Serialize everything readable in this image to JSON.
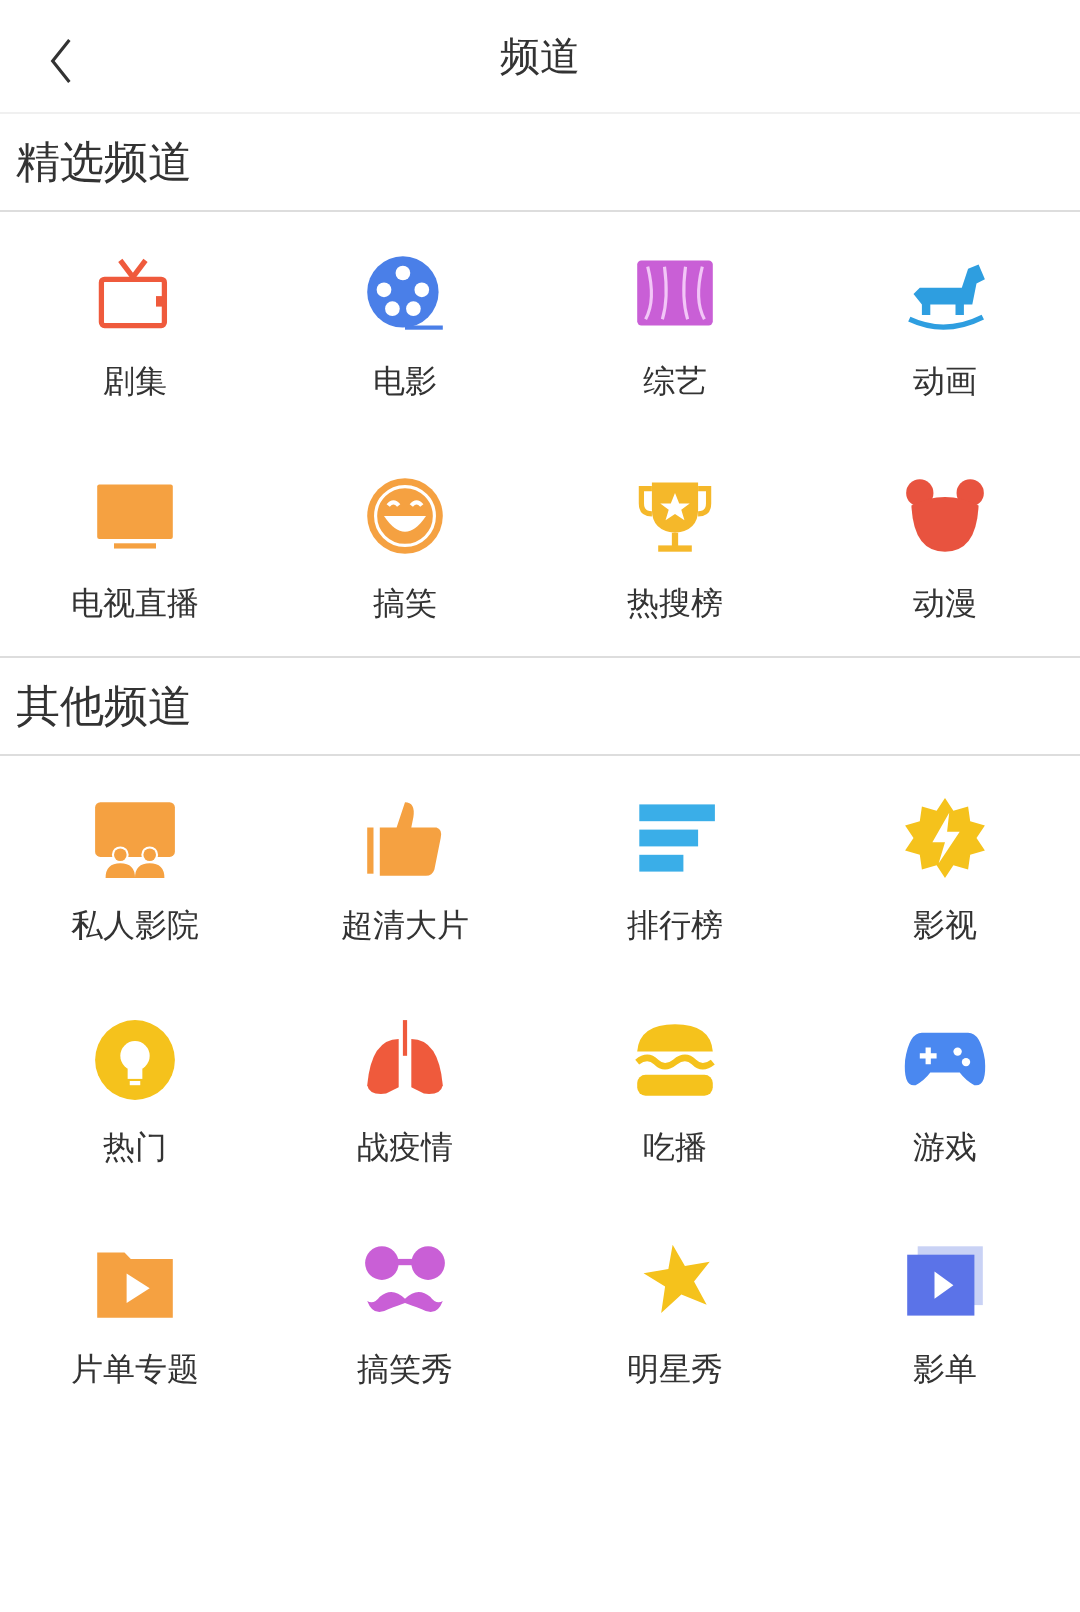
{
  "header": {
    "title": "频道"
  },
  "sections": [
    {
      "title": "精选频道",
      "items": [
        {
          "label": "剧集"
        },
        {
          "label": "电影"
        },
        {
          "label": "综艺"
        },
        {
          "label": "动画"
        },
        {
          "label": "电视直播"
        },
        {
          "label": "搞笑"
        },
        {
          "label": "热搜榜"
        },
        {
          "label": "动漫"
        }
      ]
    },
    {
      "title": "其他频道",
      "items": [
        {
          "label": "私人影院"
        },
        {
          "label": "超清大片"
        },
        {
          "label": "排行榜"
        },
        {
          "label": "影视"
        },
        {
          "label": "热门"
        },
        {
          "label": "战疫情"
        },
        {
          "label": "吃播"
        },
        {
          "label": "游戏"
        },
        {
          "label": "片单专题"
        },
        {
          "label": "搞笑秀"
        },
        {
          "label": "明星秀"
        },
        {
          "label": "影单"
        }
      ]
    }
  ]
}
